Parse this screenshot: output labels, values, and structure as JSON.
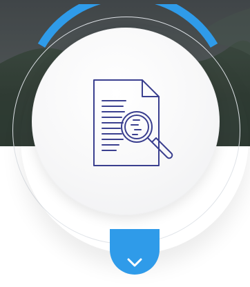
{
  "colors": {
    "accent_blue": "#2f9be9",
    "icon_navy": "#3a3f8f",
    "circle_bg": "#f4f4f5"
  },
  "icons": {
    "center": "document-search-icon",
    "down": "chevron-down-icon"
  }
}
